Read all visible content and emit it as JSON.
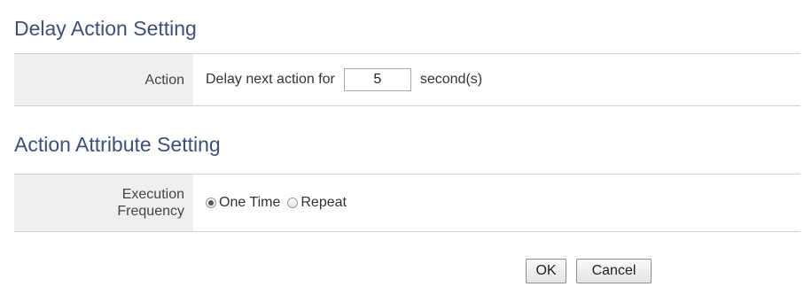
{
  "delay_section": {
    "title": "Delay Action Setting",
    "action_label": "Action",
    "prefix_text": "Delay next action for",
    "delay_value": "5",
    "suffix_text": "second(s)"
  },
  "attribute_section": {
    "title": "Action Attribute Setting",
    "frequency_label_line1": "Execution",
    "frequency_label_line2": "Frequency",
    "options": [
      {
        "label": "One Time",
        "checked": true
      },
      {
        "label": "Repeat",
        "checked": false
      }
    ]
  },
  "buttons": {
    "ok_label": "OK",
    "cancel_label": "Cancel"
  }
}
